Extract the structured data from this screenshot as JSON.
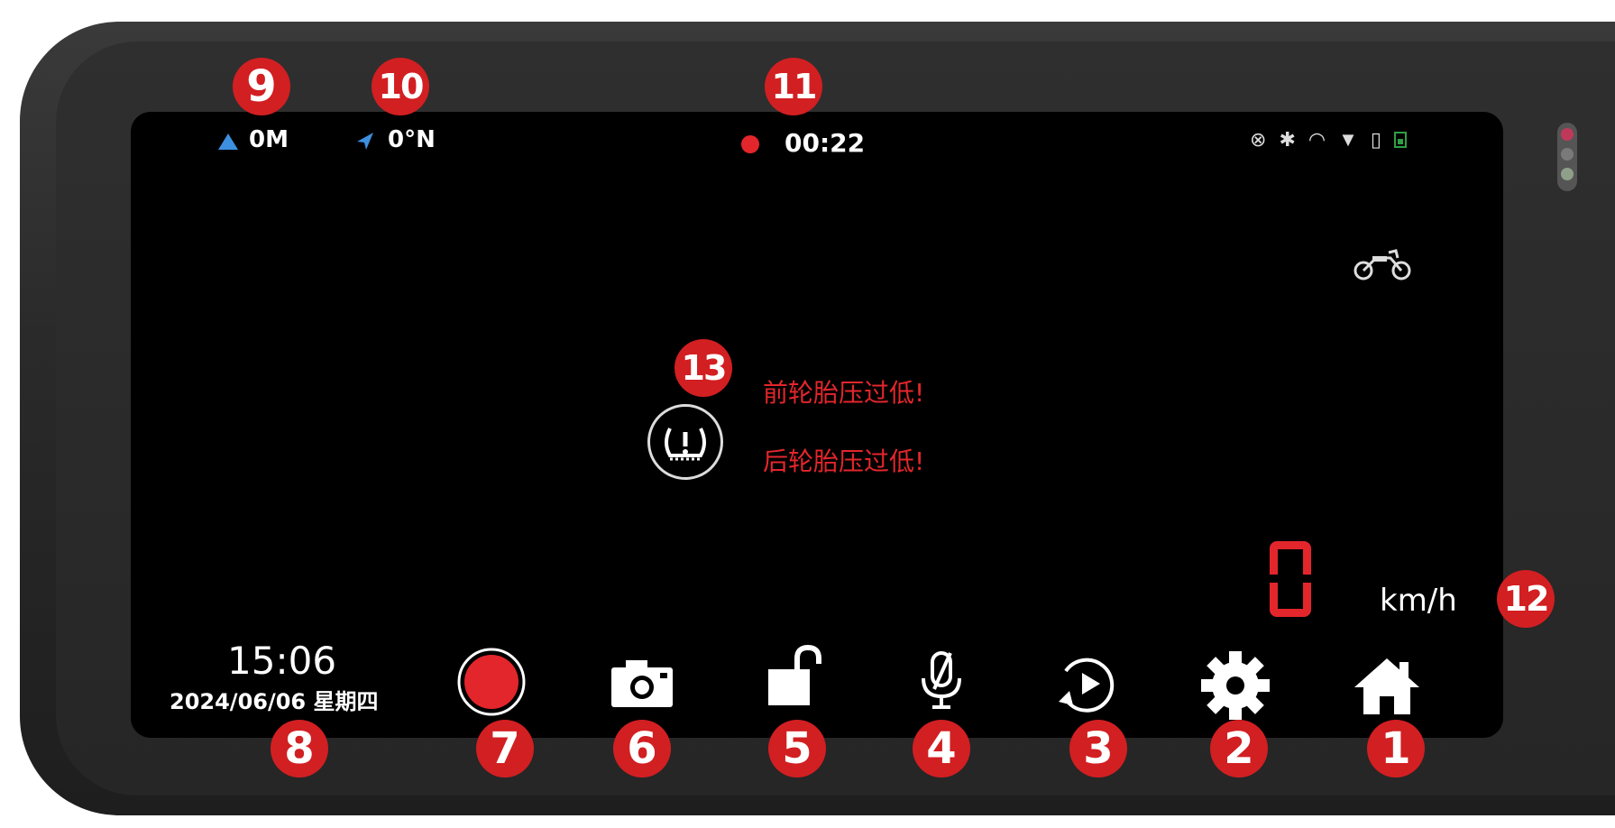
{
  "status_bar": {
    "altitude": "0M",
    "heading": "0°N",
    "record_time": "00:22",
    "icons": [
      "satellite-icon",
      "bluetooth-icon",
      "wifi-icon",
      "tpms-sensor-icon",
      "sd-card-icon",
      "battery-icon"
    ]
  },
  "vehicle_icon": "motorcycle-icon",
  "warnings": {
    "front": "前轮胎压过低!",
    "rear": "后轮胎压过低!"
  },
  "speed": {
    "value": "0",
    "unit": "km/h"
  },
  "clock": {
    "time": "15:06",
    "date": "2024/06/06  星期四"
  },
  "toolbar": {
    "items": [
      "record-button",
      "snapshot-button",
      "lock-button",
      "mic-button",
      "playback-button",
      "settings-button",
      "home-button"
    ]
  },
  "callouts": [
    "1",
    "2",
    "3",
    "4",
    "5",
    "6",
    "7",
    "8",
    "9",
    "10",
    "11",
    "12",
    "13"
  ],
  "colors": {
    "accent_red": "#e3262b",
    "badge_red": "#d21f22",
    "screen": "#000000",
    "bezel": "#2a2a2a"
  }
}
